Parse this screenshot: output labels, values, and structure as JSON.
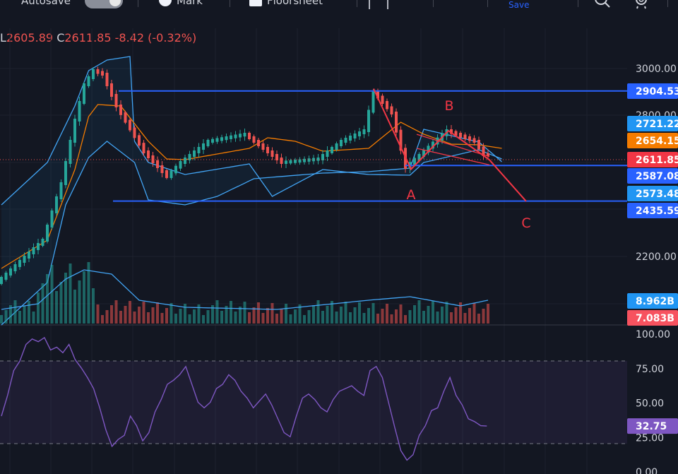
{
  "toolbar": {
    "autosave_label": "Autosave",
    "mark_label": "Mark",
    "floorsheet_label": "Floorsheet",
    "save_label": "Save",
    "icons": [
      "toggle-switch",
      "radio-button",
      "checkbox",
      "square-button",
      "plus-icon",
      "search-icon",
      "gear-icon"
    ]
  },
  "ohlc": {
    "low_label": "L",
    "low_value": "2605.89",
    "close_label": "C",
    "close_value": "2611.85",
    "change": "-8.42",
    "change_pct": "(-0.32%)"
  },
  "colors": {
    "background": "#131722",
    "up": "#26a69a",
    "down": "#ef5350",
    "bollinger": "#42a5f5",
    "ma": "#f57c00",
    "rsi": "#7e57c2",
    "hline": "#2962ff",
    "pattern": "#f23645"
  },
  "chart_data": {
    "type": "candlestick",
    "price_axis_ticks": [
      "3000.00",
      "2800.00",
      "2200.00"
    ],
    "price_range": [
      1860,
      3166
    ],
    "price_tags": [
      {
        "label": "2904.53",
        "kind": "hline"
      },
      {
        "label": "2721.22",
        "kind": "bb-upper"
      },
      {
        "label": "2654.15",
        "kind": "ma"
      },
      {
        "label": "2611.85",
        "kind": "last"
      },
      {
        "label": "2587.08",
        "kind": "hline"
      },
      {
        "label": "2573.48",
        "kind": "bb-lower"
      },
      {
        "label": "2435.59",
        "kind": "hline"
      }
    ],
    "horizontal_lines": [
      2904.53,
      2587.08,
      2435.59
    ],
    "pattern_points": [
      {
        "label": "",
        "value": 2914
      },
      {
        "label": "A",
        "value": 2571
      },
      {
        "label": "B",
        "value": 2735
      },
      {
        "label": "",
        "value": 2611
      },
      {
        "label": "C",
        "value": 2435
      }
    ],
    "volume": {
      "tags": [
        {
          "label": "8.962B",
          "kind": "vol-ma"
        },
        {
          "label": "7.083B",
          "kind": "vol"
        }
      ]
    },
    "rsi": {
      "ticks": [
        "100.00",
        "75.00",
        "50.00",
        "25.00",
        "0.00"
      ],
      "range": [
        0,
        100
      ],
      "bands": [
        80,
        20
      ],
      "value_label": "32.75",
      "values": [
        40,
        55,
        73,
        80,
        92,
        96,
        94,
        97,
        88,
        90,
        86,
        92,
        81,
        75,
        68,
        60,
        46,
        30,
        18,
        23,
        26,
        40,
        33,
        22,
        28,
        43,
        52,
        63,
        66,
        70,
        76,
        63,
        50,
        46,
        50,
        60,
        63,
        70,
        66,
        58,
        53,
        46,
        51,
        56,
        48,
        38,
        28,
        25,
        40,
        53,
        56,
        52,
        46,
        43,
        52,
        58,
        60,
        62,
        58,
        55,
        73,
        76,
        68,
        50,
        32,
        15,
        8,
        12,
        26,
        33,
        44,
        46,
        58,
        68,
        55,
        48,
        38,
        36,
        33,
        32.75
      ]
    }
  }
}
